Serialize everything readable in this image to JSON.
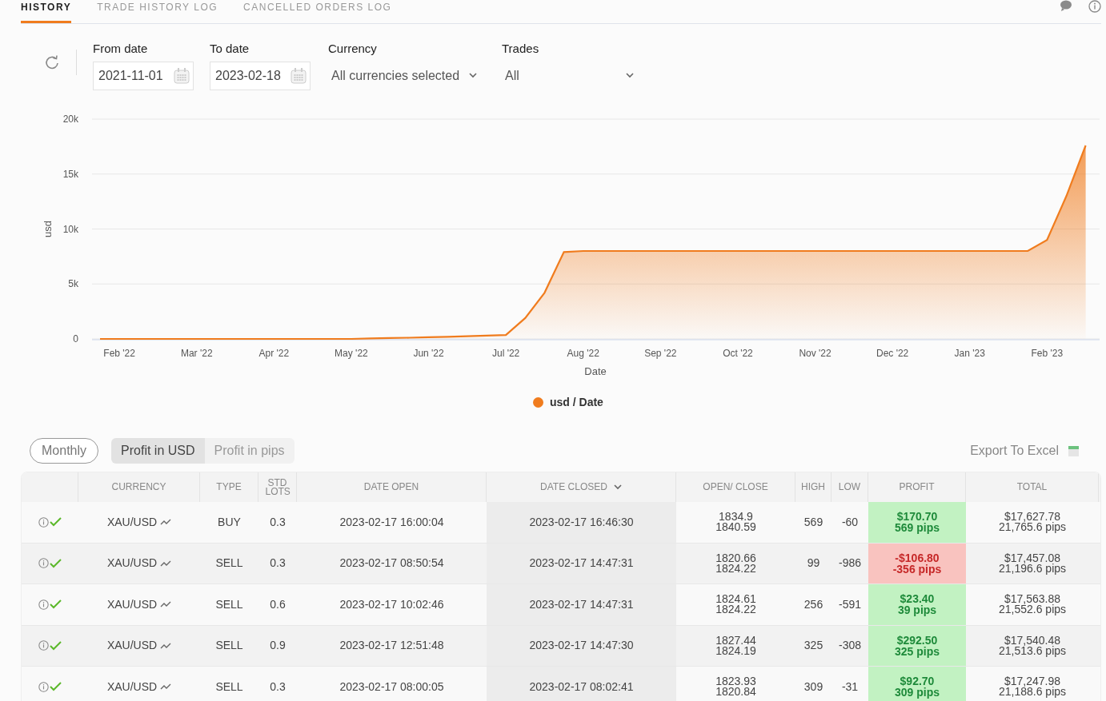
{
  "tabs": [
    {
      "label": "HISTORY",
      "selected": true
    },
    {
      "label": "TRADE HISTORY LOG",
      "selected": false
    },
    {
      "label": "CANCELLED ORDERS LOG",
      "selected": false
    }
  ],
  "filters": {
    "from": {
      "label": "From date",
      "value": "2021-11-01"
    },
    "to": {
      "label": "To date",
      "value": "2023-02-18"
    },
    "currency": {
      "label": "Currency",
      "value": "All currencies selected"
    },
    "trades": {
      "label": "Trades",
      "value": "All"
    }
  },
  "chart": {
    "chart_data": {
      "type": "area",
      "grid": true,
      "xlabel": "Date",
      "ylabel": "usd",
      "ylim": [
        0,
        20000
      ],
      "categories": [
        null,
        "Feb '22",
        null,
        null,
        null,
        "Mar '22",
        null,
        null,
        null,
        "Apr '22",
        null,
        null,
        null,
        "May '22",
        null,
        null,
        null,
        "Jun '22",
        null,
        null,
        null,
        "Jul '22",
        null,
        null,
        null,
        "Aug '22",
        null,
        null,
        null,
        "Sep '22",
        null,
        null,
        null,
        "Oct '22",
        null,
        null,
        null,
        "Nov '22",
        null,
        null,
        null,
        "Dec '22",
        null,
        null,
        null,
        "Jan '23",
        null,
        null,
        null,
        "Feb '23",
        null,
        null
      ],
      "yticks": [
        {
          "value": 0,
          "label": "0"
        },
        {
          "value": 5000,
          "label": "5k"
        },
        {
          "value": 10000,
          "label": "10k"
        },
        {
          "value": 15000,
          "label": "15k"
        },
        {
          "value": 20000,
          "label": "20k"
        }
      ],
      "series": [
        {
          "name": "usd / Date",
          "color": "#f07c1e",
          "values": [
            0,
            0,
            0,
            0,
            0,
            0,
            0,
            0,
            0,
            0,
            0,
            0,
            0,
            0,
            40,
            80,
            110,
            150,
            200,
            250,
            300,
            350,
            1900,
            4200,
            7900,
            8000,
            8000,
            8000,
            8000,
            8000,
            8000,
            8000,
            8000,
            8000,
            8000,
            8000,
            8000,
            8000,
            8000,
            8000,
            8000,
            8000,
            8000,
            8000,
            8000,
            8000,
            8000,
            8000,
            8000,
            9000,
            13000,
            17600
          ]
        }
      ]
    }
  },
  "view": {
    "monthly": "Monthly",
    "modes": [
      {
        "label": "Profit in USD",
        "selected": true
      },
      {
        "label": "Profit in pips",
        "selected": false
      }
    ],
    "export": "Export To Excel"
  },
  "table": {
    "columns": [
      "",
      "CURRENCY",
      "TYPE",
      "STD LOTS",
      "DATE OPEN",
      "DATE CLOSED",
      "OPEN/ CLOSE",
      "HIGH",
      "LOW",
      "PROFIT",
      "TOTAL"
    ],
    "rows": [
      {
        "currency": "XAU/USD",
        "type": "BUY",
        "lots": "0.3",
        "open_date": "2023-02-17 16:00:04",
        "close_date": "2023-02-17 16:46:30",
        "open": "1834.9",
        "close": "1840.59",
        "high": "569",
        "low": "-60",
        "profit": "$170.70",
        "profit_pips": "569 pips",
        "kind": "gain",
        "total": "$17,627.78",
        "total_pips": "21,765.6 pips"
      },
      {
        "currency": "XAU/USD",
        "type": "SELL",
        "lots": "0.3",
        "open_date": "2023-02-17 08:50:54",
        "close_date": "2023-02-17 14:47:31",
        "open": "1820.66",
        "close": "1824.22",
        "high": "99",
        "low": "-986",
        "profit": "-$106.80",
        "profit_pips": "-356 pips",
        "kind": "loss",
        "total": "$17,457.08",
        "total_pips": "21,196.6 pips"
      },
      {
        "currency": "XAU/USD",
        "type": "SELL",
        "lots": "0.6",
        "open_date": "2023-02-17 10:02:46",
        "close_date": "2023-02-17 14:47:31",
        "open": "1824.61",
        "close": "1824.22",
        "high": "256",
        "low": "-591",
        "profit": "$23.40",
        "profit_pips": "39 pips",
        "kind": "gain",
        "total": "$17,563.88",
        "total_pips": "21,552.6 pips"
      },
      {
        "currency": "XAU/USD",
        "type": "SELL",
        "lots": "0.9",
        "open_date": "2023-02-17 12:51:48",
        "close_date": "2023-02-17 14:47:30",
        "open": "1827.44",
        "close": "1824.19",
        "high": "325",
        "low": "-308",
        "profit": "$292.50",
        "profit_pips": "325 pips",
        "kind": "gain",
        "total": "$17,540.48",
        "total_pips": "21,513.6 pips"
      },
      {
        "currency": "XAU/USD",
        "type": "SELL",
        "lots": "0.3",
        "open_date": "2023-02-17 08:00:05",
        "close_date": "2023-02-17 08:02:41",
        "open": "1823.93",
        "close": "1820.84",
        "high": "309",
        "low": "-31",
        "profit": "$92.70",
        "profit_pips": "309 pips",
        "kind": "gain",
        "total": "$17,247.98",
        "total_pips": "21,188.6 pips"
      }
    ]
  }
}
